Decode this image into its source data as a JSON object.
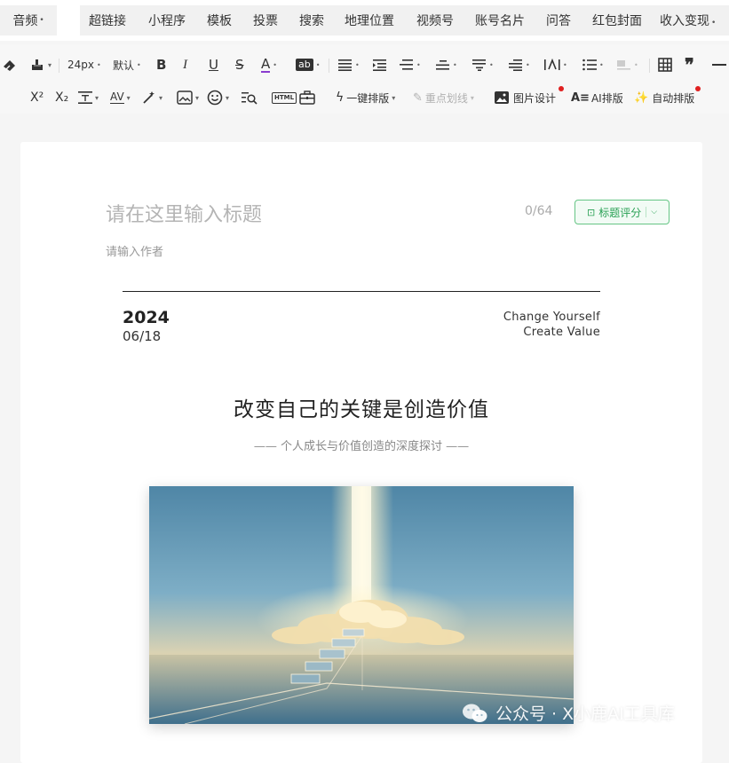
{
  "menubar": {
    "first": {
      "label": "音频"
    },
    "items": [
      {
        "label": "超链接"
      },
      {
        "label": "小程序"
      },
      {
        "label": "模板"
      },
      {
        "label": "投票"
      },
      {
        "label": "搜索"
      },
      {
        "label": "地理位置"
      },
      {
        "label": "视频号"
      },
      {
        "label": "账号名片"
      },
      {
        "label": "问答"
      },
      {
        "label": "红包封面"
      },
      {
        "label": "收入变现"
      }
    ]
  },
  "toolbar": {
    "font_size": "24px",
    "font_family": "默认",
    "bold": "B",
    "italic": "I",
    "underline": "U",
    "strike": "S",
    "font_color": "A",
    "highlight": "ab",
    "superscript": "X²",
    "subscript": "X₂",
    "letter_spacing": "AV",
    "html": "HTML",
    "one_click_layout": "一键排版",
    "key_underline": "重点划线",
    "image_design": "图片设计",
    "ai_layout": "AI排版",
    "auto_layout": "自动排版",
    "accent_color": "#e02020"
  },
  "editor": {
    "title_placeholder": "请在这里输入标题",
    "title_counter": "0/64",
    "title_score_label": "标题评分",
    "author_placeholder": "请输入作者",
    "article": {
      "year": "2024",
      "date": "06/18",
      "slogan_line1": "Change Yourself",
      "slogan_line2": "Create Value",
      "headline": "改变自己的关键是创造价值",
      "subheadline": "—— 个人成长与价值创造的深度探讨 ——"
    }
  },
  "watermark": {
    "text": "公众号 · X小鹿AI工具库"
  },
  "colors": {
    "green_accent": "#2aa155",
    "paper": "#ffffff",
    "background": "#f5f5f5"
  }
}
